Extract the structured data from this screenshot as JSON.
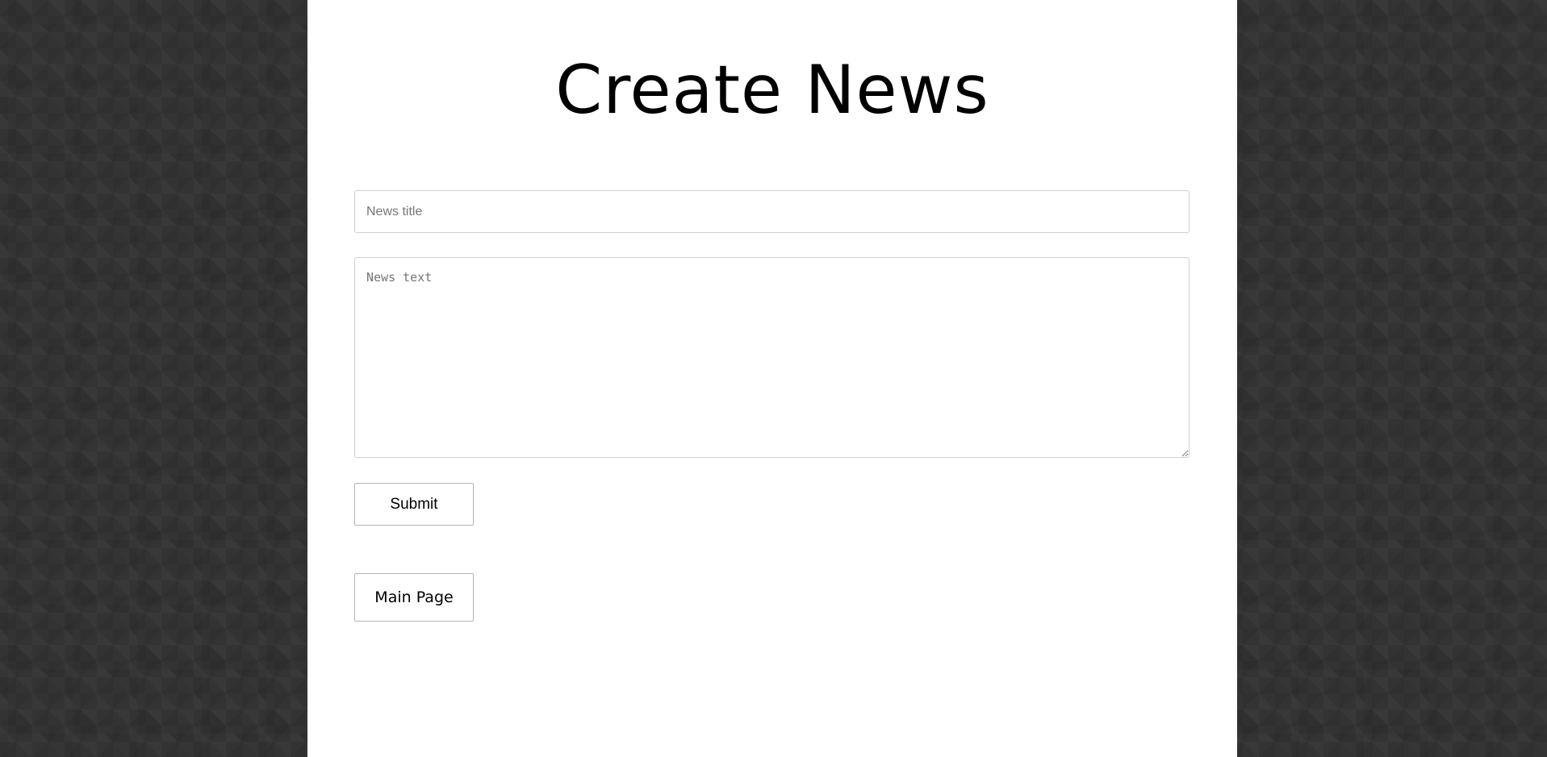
{
  "page": {
    "title": "Create News"
  },
  "form": {
    "title_placeholder": "News title",
    "title_value": "",
    "text_placeholder": "News text",
    "text_value": "",
    "submit_label": "Submit"
  },
  "nav": {
    "main_page_label": "Main Page"
  },
  "colors": {
    "background": "#333333",
    "panel": "#ffffff",
    "border": "#cfcfcf",
    "placeholder": "#757575"
  }
}
